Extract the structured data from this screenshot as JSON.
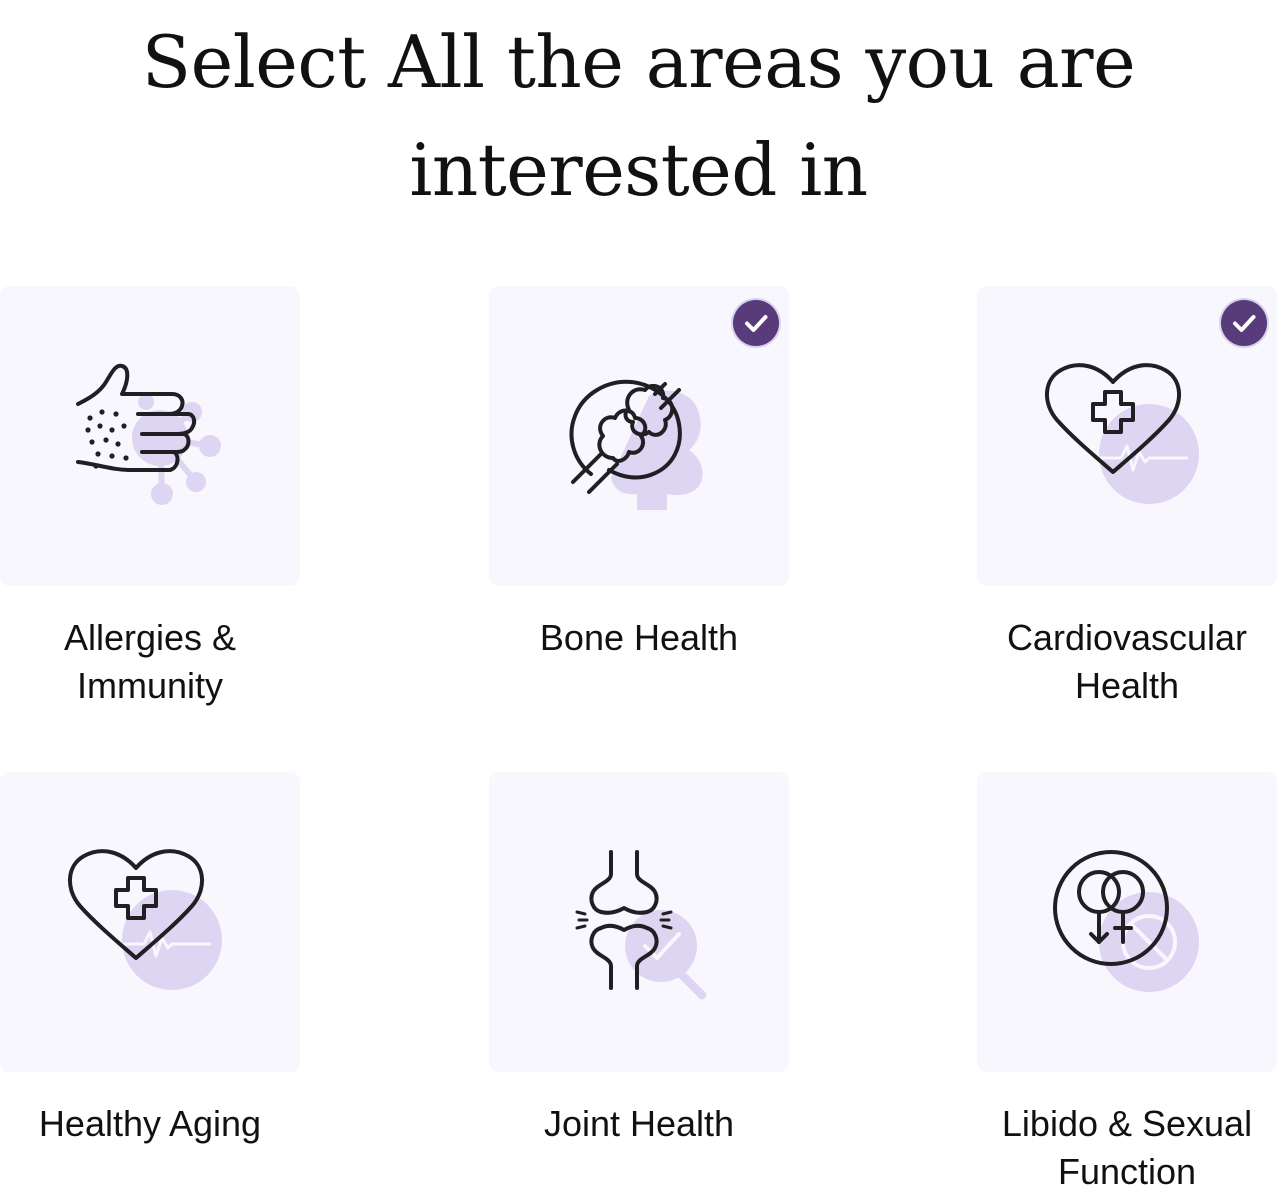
{
  "title": {
    "line1": "Select All the areas you are",
    "line2": "interested in"
  },
  "colors": {
    "card_background": "#f8f7fd",
    "accent_purple": "#573b7a",
    "illustration_tint": "#ddd5f2",
    "icon_stroke": "#1f1f24"
  },
  "options": [
    {
      "label_line1": "Allergies &",
      "label_line2": "Immunity",
      "selected": false,
      "icon": "allergy-hand-icon"
    },
    {
      "label_line1": "Bone Health",
      "label_line2": "",
      "selected": true,
      "icon": "bone-icon"
    },
    {
      "label_line1": "Cardiovascular",
      "label_line2": "Health",
      "selected": true,
      "icon": "heart-cross-icon"
    },
    {
      "label_line1": "Healthy Aging",
      "label_line2": "",
      "selected": false,
      "icon": "heart-cross-icon"
    },
    {
      "label_line1": "Joint Health",
      "label_line2": "",
      "selected": false,
      "icon": "joint-icon"
    },
    {
      "label_line1": "Libido & Sexual",
      "label_line2": "Function",
      "selected": false,
      "icon": "gender-symbols-icon"
    }
  ]
}
